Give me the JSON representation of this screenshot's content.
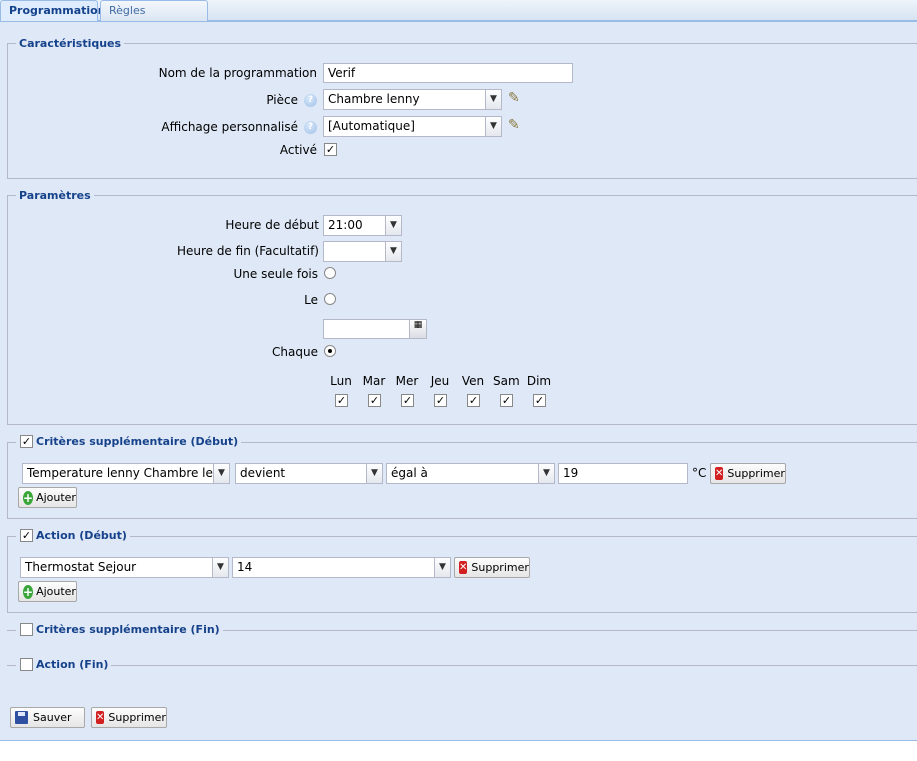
{
  "tabs": [
    {
      "label": "Programmation",
      "active": true
    },
    {
      "label": "Règles associées",
      "active": false
    }
  ],
  "caracteristiques": {
    "legend": "Caractéristiques",
    "nom_label": "Nom de la programmation",
    "nom_value": "Verif",
    "piece_label": "Pièce",
    "piece_value": "Chambre lenny",
    "affichage_label": "Affichage personnalisé",
    "affichage_value": "[Automatique]",
    "active_label": "Activé",
    "active_checked": true
  },
  "parametres": {
    "legend": "Paramètres",
    "debut_label": "Heure de début",
    "debut_value": "21:00",
    "fin_label": "Heure de fin (Facultatif)",
    "fin_value": "",
    "une_fois_label": "Une seule fois",
    "le_label": "Le",
    "date_value": "",
    "chaque_label": "Chaque",
    "chaque_selected": true,
    "days": [
      "Lun",
      "Mar",
      "Mer",
      "Jeu",
      "Ven",
      "Sam",
      "Dim"
    ],
    "days_checked": [
      true,
      true,
      true,
      true,
      true,
      true,
      true
    ]
  },
  "criteres_debut": {
    "legend": "Critères supplémentaire (Début)",
    "checked": true,
    "device": "Temperature lenny Chambre lenny",
    "mode": "devient",
    "operator": "égal à",
    "value": "19",
    "unit": "°C",
    "delete_label": "Supprimer",
    "add_label": "Ajouter"
  },
  "action_debut": {
    "legend": "Action (Début)",
    "checked": true,
    "device": "Thermostat Sejour",
    "value": "14",
    "delete_label": "Supprimer",
    "add_label": "Ajouter"
  },
  "criteres_fin": {
    "legend": "Critères supplémentaire (Fin)",
    "checked": false
  },
  "action_fin": {
    "legend": "Action (Fin)",
    "checked": false
  },
  "footer": {
    "save_label": "Sauver",
    "delete_label": "Supprimer"
  },
  "icons": {
    "help": "help-icon",
    "edit": "pencil-icon",
    "calendar": "calendar-icon"
  },
  "colors": {
    "panel_bg": "#dfe8f6",
    "legend_text": "#15428b",
    "border": "#99bbe8"
  }
}
